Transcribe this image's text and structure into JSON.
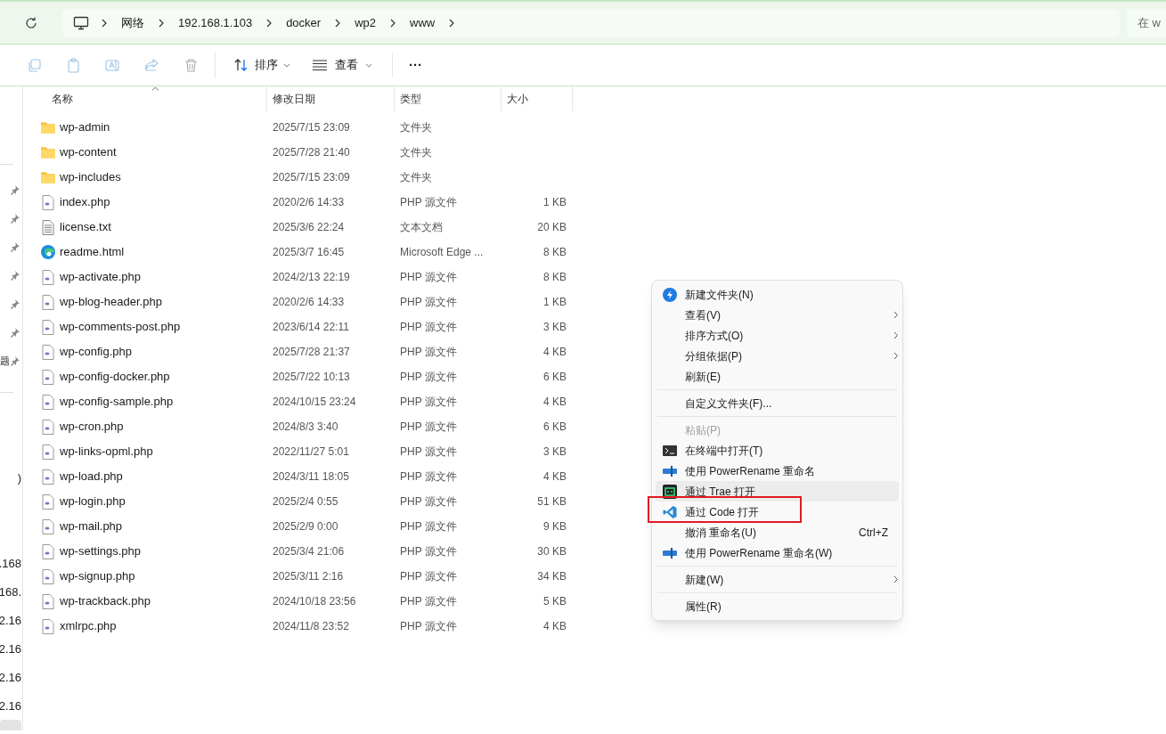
{
  "address_bar": {
    "crumbs": [
      "网络",
      "192.168.1.103",
      "docker",
      "wp2",
      "www"
    ],
    "search_placeholder": "在 w"
  },
  "toolbar": {
    "sort": "排序",
    "view": "查看",
    "more": "···"
  },
  "sidebar": {
    "pinned_labels": [
      "题"
    ],
    "fragments": [
      ")",
      ".168",
      "168.",
      "2.16",
      "2.16",
      "2.16",
      "2.16"
    ]
  },
  "table": {
    "columns": [
      "名称",
      "修改日期",
      "类型",
      "大小"
    ],
    "rows": [
      {
        "name": "wp-admin",
        "kind": "folder",
        "date": "2025/7/15 23:09",
        "type": "文件夹",
        "size": ""
      },
      {
        "name": "wp-content",
        "kind": "folder",
        "date": "2025/7/28 21:40",
        "type": "文件夹",
        "size": ""
      },
      {
        "name": "wp-includes",
        "kind": "folder",
        "date": "2025/7/15 23:09",
        "type": "文件夹",
        "size": ""
      },
      {
        "name": "index.php",
        "kind": "php",
        "date": "2020/2/6 14:33",
        "type": "PHP 源文件",
        "size": "1 KB"
      },
      {
        "name": "license.txt",
        "kind": "text",
        "date": "2025/3/6 22:24",
        "type": "文本文档",
        "size": "20 KB"
      },
      {
        "name": "readme.html",
        "kind": "html",
        "date": "2025/3/7 16:45",
        "type": "Microsoft Edge ...",
        "size": "8 KB"
      },
      {
        "name": "wp-activate.php",
        "kind": "php",
        "date": "2024/2/13 22:19",
        "type": "PHP 源文件",
        "size": "8 KB"
      },
      {
        "name": "wp-blog-header.php",
        "kind": "php",
        "date": "2020/2/6 14:33",
        "type": "PHP 源文件",
        "size": "1 KB"
      },
      {
        "name": "wp-comments-post.php",
        "kind": "php",
        "date": "2023/6/14 22:11",
        "type": "PHP 源文件",
        "size": "3 KB"
      },
      {
        "name": "wp-config.php",
        "kind": "php",
        "date": "2025/7/28 21:37",
        "type": "PHP 源文件",
        "size": "4 KB"
      },
      {
        "name": "wp-config-docker.php",
        "kind": "php",
        "date": "2025/7/22 10:13",
        "type": "PHP 源文件",
        "size": "6 KB"
      },
      {
        "name": "wp-config-sample.php",
        "kind": "php",
        "date": "2024/10/15 23:24",
        "type": "PHP 源文件",
        "size": "4 KB"
      },
      {
        "name": "wp-cron.php",
        "kind": "php",
        "date": "2024/8/3 3:40",
        "type": "PHP 源文件",
        "size": "6 KB"
      },
      {
        "name": "wp-links-opml.php",
        "kind": "php",
        "date": "2022/11/27 5:01",
        "type": "PHP 源文件",
        "size": "3 KB"
      },
      {
        "name": "wp-load.php",
        "kind": "php",
        "date": "2024/3/11 18:05",
        "type": "PHP 源文件",
        "size": "4 KB"
      },
      {
        "name": "wp-login.php",
        "kind": "php",
        "date": "2025/2/4 0:55",
        "type": "PHP 源文件",
        "size": "51 KB"
      },
      {
        "name": "wp-mail.php",
        "kind": "php",
        "date": "2025/2/9 0:00",
        "type": "PHP 源文件",
        "size": "9 KB"
      },
      {
        "name": "wp-settings.php",
        "kind": "php",
        "date": "2025/3/4 21:06",
        "type": "PHP 源文件",
        "size": "30 KB"
      },
      {
        "name": "wp-signup.php",
        "kind": "php",
        "date": "2025/3/11 2:16",
        "type": "PHP 源文件",
        "size": "34 KB"
      },
      {
        "name": "wp-trackback.php",
        "kind": "php",
        "date": "2024/10/18 23:56",
        "type": "PHP 源文件",
        "size": "5 KB"
      },
      {
        "name": "xmlrpc.php",
        "kind": "php",
        "date": "2024/11/8 23:52",
        "type": "PHP 源文件",
        "size": "4 KB"
      }
    ]
  },
  "context_menu": [
    {
      "kind": "item",
      "label": "新建文件夹(N)",
      "disabled": false,
      "hovered": false,
      "submenu": false
    },
    {
      "kind": "item",
      "label": "查看(V)",
      "disabled": false,
      "hovered": false,
      "submenu": true
    },
    {
      "kind": "item",
      "label": "排序方式(O)",
      "disabled": false,
      "hovered": false,
      "submenu": true
    },
    {
      "kind": "item",
      "label": "分组依据(P)",
      "disabled": false,
      "hovered": false,
      "submenu": true
    },
    {
      "kind": "item",
      "label": "刷新(E)",
      "disabled": false,
      "hovered": false,
      "submenu": false
    },
    {
      "kind": "separator"
    },
    {
      "kind": "item",
      "label": "自定义文件夹(F)...",
      "disabled": false,
      "hovered": false,
      "submenu": false
    },
    {
      "kind": "separator"
    },
    {
      "kind": "item",
      "label": "粘贴(P)",
      "disabled": true,
      "hovered": false,
      "submenu": false
    },
    {
      "kind": "item",
      "label": "在终端中打开(T)",
      "disabled": false,
      "hovered": false,
      "submenu": false
    },
    {
      "kind": "item",
      "label": "使用 PowerRename 重命名",
      "disabled": false,
      "hovered": false,
      "submenu": false
    },
    {
      "kind": "item",
      "label": "通过 Trae 打开",
      "disabled": false,
      "hovered": true,
      "submenu": false
    },
    {
      "kind": "item",
      "label": "通过 Code 打开",
      "disabled": false,
      "hovered": false,
      "submenu": false,
      "annotated": true
    },
    {
      "kind": "item",
      "label": "撤消 重命名(U)",
      "shortcut": "Ctrl+Z",
      "disabled": false,
      "hovered": false,
      "submenu": false
    },
    {
      "kind": "item",
      "label": "使用 PowerRename 重命名(W)",
      "disabled": false,
      "hovered": false,
      "submenu": false
    },
    {
      "kind": "separator"
    },
    {
      "kind": "item",
      "label": "新建(W)",
      "disabled": false,
      "hovered": false,
      "submenu": true
    },
    {
      "kind": "separator"
    },
    {
      "kind": "item",
      "label": "属性(R)",
      "disabled": false,
      "hovered": false,
      "submenu": false
    }
  ]
}
